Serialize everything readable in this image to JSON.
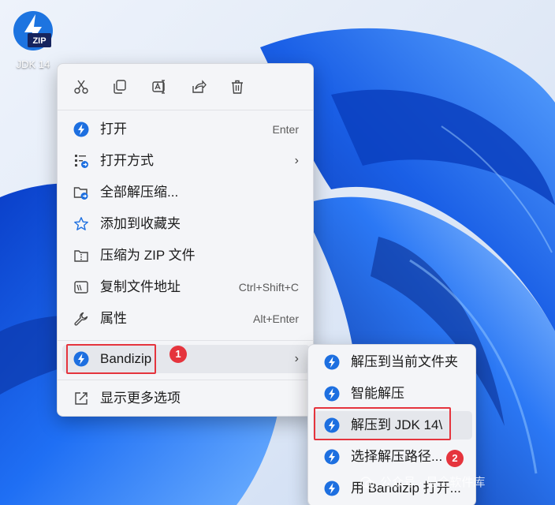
{
  "desktop": {
    "icon_label": "JDK 14",
    "icon_badge": "ZIP",
    "colors": {
      "wallpaper_base": "#1e6cf0",
      "wallpaper_light": "#dde7f6"
    }
  },
  "context_menu": {
    "toolbar": [
      "cut-icon",
      "copy-icon",
      "rename-icon",
      "share-icon",
      "delete-icon"
    ],
    "items": [
      {
        "label": "打开",
        "shortcut": "Enter",
        "icon": "bandizip-icon"
      },
      {
        "label": "打开方式",
        "has_submenu": true,
        "icon": "open-with-icon"
      },
      {
        "label": "全部解压缩...",
        "icon": "extract-folder-icon"
      },
      {
        "label": "添加到收藏夹",
        "icon": "star-icon"
      },
      {
        "label": "压缩为 ZIP 文件",
        "icon": "zip-folder-icon"
      },
      {
        "label": "复制文件地址",
        "shortcut": "Ctrl+Shift+C",
        "icon": "copy-path-icon"
      },
      {
        "label": "属性",
        "shortcut": "Alt+Enter",
        "icon": "wrench-icon"
      },
      {
        "label": "Bandizip",
        "has_submenu": true,
        "icon": "bandizip-icon",
        "highlighted": true
      },
      {
        "label": "显示更多选项",
        "icon": "show-more-icon"
      }
    ],
    "arrow_glyph": "›"
  },
  "submenu": {
    "items": [
      {
        "label": "解压到当前文件夹"
      },
      {
        "label": "智能解压"
      },
      {
        "label": "解压到 JDK 14\\",
        "highlighted": true
      },
      {
        "label": "选择解压路径..."
      },
      {
        "label": "用 Bandizip 打开..."
      }
    ]
  },
  "annotations": {
    "badge_1": "1",
    "badge_2": "2",
    "highlight_color": "#e5343d"
  },
  "watermark": {
    "text": "公众号 · 最全软件库"
  }
}
